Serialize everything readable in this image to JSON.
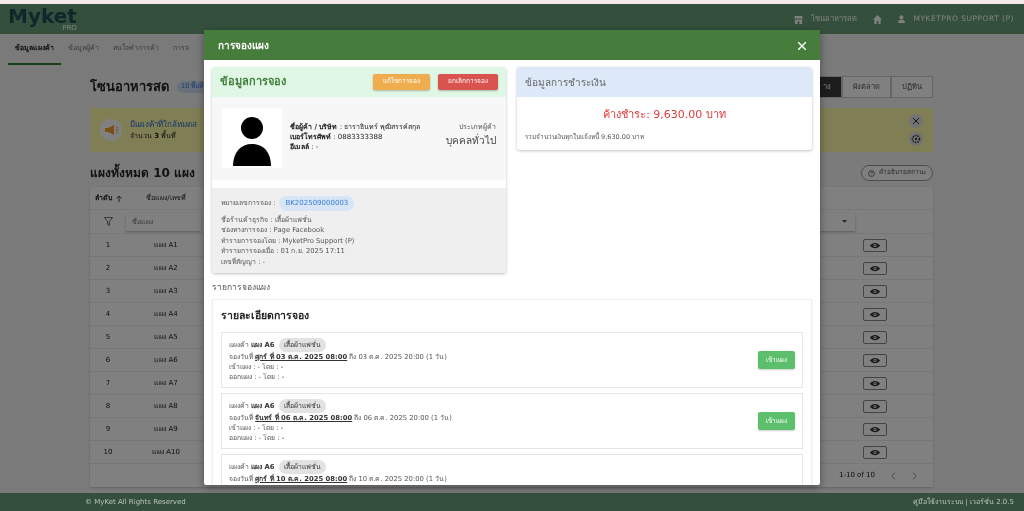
{
  "navbar": {
    "logo": "Myket",
    "logo_sub": "PRO",
    "zone": "โซนอาหารสด",
    "user": "MYKETPRO SUPPORT (P)"
  },
  "tabs": [
    {
      "label": "ข้อมูลแผงค้า",
      "selected": true
    },
    {
      "label": "ข้อมูลผู้ค้า",
      "selected": false
    },
    {
      "label": "สนใจทำการค้า",
      "selected": false
    },
    {
      "label": "การจ",
      "selected": false
    }
  ],
  "zone": {
    "title": "โซนอาหารสด",
    "badge": "10 พื้นที่",
    "views": [
      {
        "label": "าง",
        "selected": true
      },
      {
        "label": "ผังตลาด",
        "selected": false
      },
      {
        "label": "ปฏิทิน",
        "selected": false
      }
    ]
  },
  "alert": {
    "title": "มีแผงค้าที่ใกล้หมดส",
    "text": "จำนวน **3** พื้นที่"
  },
  "stalls": {
    "title": "แผงทั้งหมด 10 แผง",
    "legend_button": "คำอธิบายสถานะ",
    "columns": [
      "ลำดับ",
      "ชื่อแผง/เลขที่"
    ],
    "filter_placeholder": "ชื่อแผง",
    "rows": [
      {
        "no": "1",
        "name": "แผง A1"
      },
      {
        "no": "2",
        "name": "แผง A2"
      },
      {
        "no": "3",
        "name": "แผง A3"
      },
      {
        "no": "4",
        "name": "แผง A4"
      },
      {
        "no": "5",
        "name": "แผง A5"
      },
      {
        "no": "6",
        "name": "แผง A6"
      },
      {
        "no": "7",
        "name": "แผง A7"
      },
      {
        "no": "8",
        "name": "แผง A8"
      },
      {
        "no": "9",
        "name": "แผง A9"
      },
      {
        "no": "10",
        "name": "แผง A10"
      }
    ],
    "pagination": "1-10 of 10"
  },
  "footer": {
    "left": "© MyKet All Rights Reserved",
    "right": "คู่มือใช้งานระบบ | เวอร์ชั่น 2.0.5"
  },
  "modal": {
    "title": "การจองแผง",
    "booking_info": {
      "title": "ข้อมูลการจอง",
      "edit_button": "แก้ไขการจอง",
      "cancel_button": "ยกเลิกการจอง",
      "customer": [
        "**ชื่อผู้ค้า / บริษัท** : ธาราธินทร์ พุฒิสรรค์สกุล",
        "**เบอร์โทรศัพท์** : 0883333388",
        "**อีเมลล์** : -"
      ],
      "type_label": "ประเภทผู้ค้า",
      "type": "บุคคลทั่วไป",
      "number_label": "หมายเลขการจอง :",
      "number": "BK202509000003",
      "details": [
        "ชื่อร้านค้าธุรกิจ : เสื้อผ้าแฟชั่น",
        "ช่องทางการจอง : Page Facebook",
        "ทำรายการจองโดย : MyketPro Support (P)",
        "ทำรายการจองเมื่อ : 01 ก.ย. 2025 17:11",
        "เลขที่สัญญา : -"
      ]
    },
    "payment": {
      "title": "ข้อมูลการชำระเงิน",
      "outstanding": "ค้างชำระ: 9,630.00 บาท",
      "total": "รวมจำนวนเงินทุกใบแจ้งหนี้ 9,630.00 บาท"
    },
    "list_title": "รายการจองแผง",
    "detail_title": "รายละเอียดการจอง",
    "bookings": [
      {
        "stall": "แผงค้า **แผง A6**",
        "category": "เสื้อผ้าแฟชั่น",
        "date": "จองวันที่ **ศุกร์ ที่ 03 ต.ค. 2025 08:00** ถึง 03 ต.ค. 2025 20:00 (1 วัน)",
        "check_in": "เข้าแผง : - โดย : -",
        "check_out": "ออกแผง : - โดย : -",
        "button": "เข้าแผง"
      },
      {
        "stall": "แผงค้า **แผง A6**",
        "category": "เสื้อผ้าแฟชั่น",
        "date": "จองวันที่ **จันทร์ ที่ 06 ต.ค. 2025 08:00** ถึง 06 ต.ค. 2025 20:00 (1 วัน)",
        "check_in": "เข้าแผง : - โดย : -",
        "check_out": "ออกแผง : - โดย : -",
        "button": "เข้าแผง"
      },
      {
        "stall": "แผงค้า **แผง A6**",
        "category": "เสื้อผ้าแฟชั่น",
        "date": "จองวันที่ **ศุกร์ ที่ 10 ต.ค. 2025 08:00** ถึง 10 ต.ค. 2025 20:00 (1 วัน)"
      }
    ]
  }
}
